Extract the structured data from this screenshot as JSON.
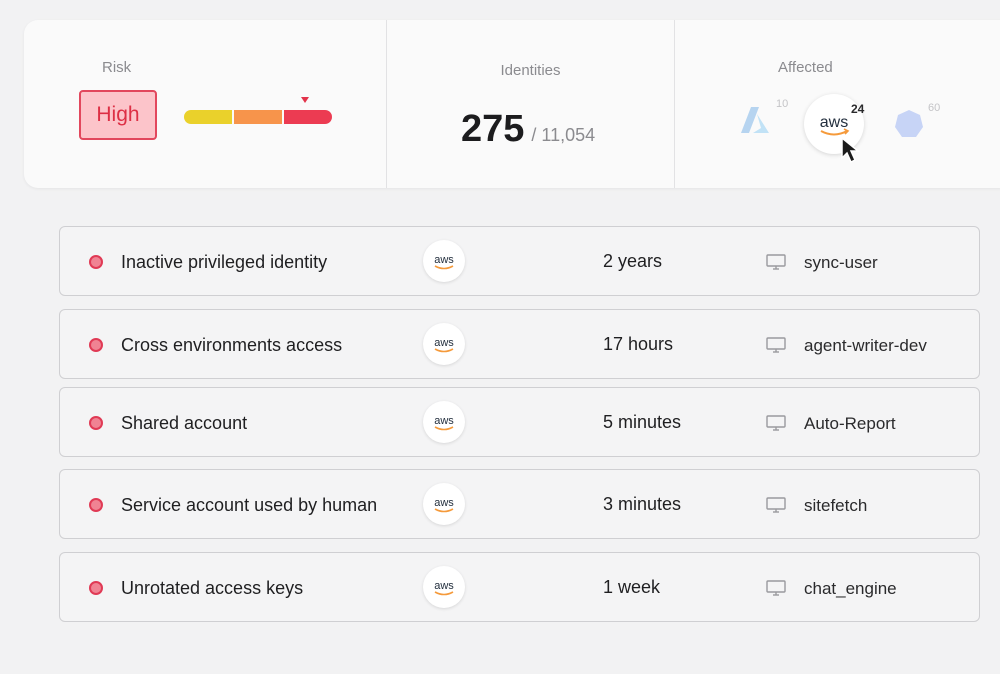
{
  "summary": {
    "risk": {
      "label": "Risk",
      "level": "High",
      "bar_colors": [
        "#ead12b",
        "#f7944b",
        "#ec3b52"
      ]
    },
    "identities": {
      "label": "Identities",
      "count": "275",
      "total": "/ 11,054"
    },
    "affected": {
      "label": "Affected",
      "providers": [
        {
          "icon": "azure-icon",
          "count": "10"
        },
        {
          "icon": "aws-logo",
          "count": "24"
        },
        {
          "icon": "kubernetes-icon",
          "count": "60"
        }
      ]
    }
  },
  "findings": [
    {
      "title": "Inactive privileged identity",
      "provider_icon": "aws-logo",
      "duration": "2 years",
      "host_icon": "monitor-icon",
      "host": "sync-user"
    },
    {
      "title": "Cross environments access",
      "provider_icon": "aws-logo",
      "duration": "17 hours",
      "host_icon": "monitor-icon",
      "host": "agent-writer-dev"
    },
    {
      "title": "Shared account",
      "provider_icon": "aws-logo",
      "duration": "5 minutes",
      "host_icon": "monitor-icon",
      "host": "Auto-Report"
    },
    {
      "title": "Service account used by human",
      "provider_icon": "aws-logo",
      "duration": "3 minutes",
      "host_icon": "monitor-icon",
      "host": "sitefetch"
    },
    {
      "title": "Unrotated access keys",
      "provider_icon": "aws-logo",
      "duration": "1 week",
      "host_icon": "monitor-icon",
      "host": "chat_engine"
    }
  ],
  "colors": {
    "danger": "#e03a55",
    "badge_bg": "#fcc4ca",
    "aws_orange": "#f59a3b"
  }
}
